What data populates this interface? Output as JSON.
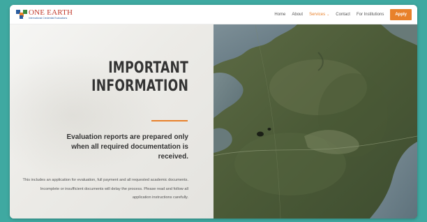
{
  "header": {
    "logo": {
      "title": "ONE EARTH",
      "subtitle": "International Credential Evaluations"
    },
    "nav": {
      "items": [
        {
          "label": "Home"
        },
        {
          "label": "About"
        },
        {
          "label": "Services",
          "dropdown": true,
          "active": true
        },
        {
          "label": "Contact"
        },
        {
          "label": "For Institutions"
        }
      ],
      "apply_label": "Apply"
    }
  },
  "main": {
    "heading_line1": "IMPORTANT",
    "heading_line2": "INFORMATION",
    "subheading": "Evaluation reports are prepared only when all required documentation is received.",
    "body": "This includes an application for evaluation, full payment and all requested academic documents. Incomplete or insufficient documents will delay the process. Please read and follow all application instructions carefully."
  },
  "colors": {
    "accent": "#e8812a",
    "frame_background": "#3fa9a1",
    "logo_red": "#c0392b",
    "logo_blue": "#2a5d9f"
  },
  "icons": {
    "dropdown": "chevron-down-icon",
    "logo_mark": "one-earth-logo-icon"
  },
  "image": {
    "description": "aerial satellite view of a landscape with water and green terrain"
  }
}
